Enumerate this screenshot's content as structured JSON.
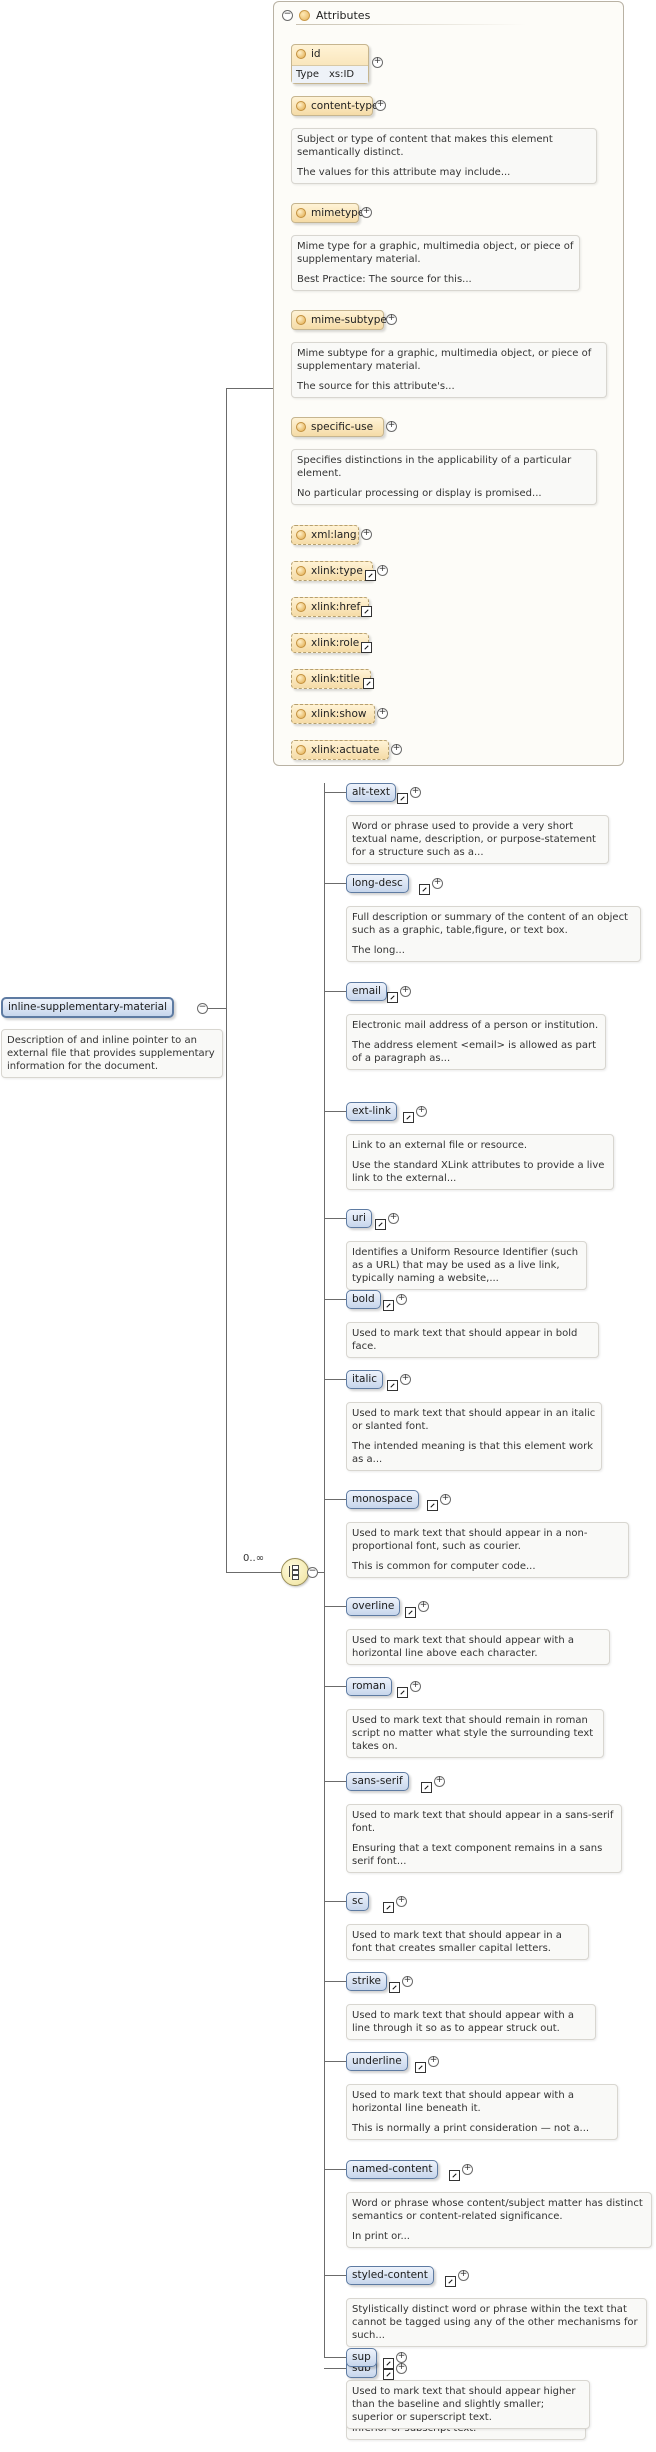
{
  "root": {
    "name": "inline-supplementary-material",
    "description": [
      "Description of and inline pointer to an external file that provides supplementary information for the document."
    ]
  },
  "attributes_group": {
    "label": "Attributes",
    "items": [
      {
        "name": "id",
        "type_label": "Type",
        "type_value": "xs:ID",
        "description": []
      },
      {
        "name": "content-type",
        "description": [
          "Subject or type of content that makes this element semantically distinct.",
          "The values for this attribute may include..."
        ]
      },
      {
        "name": "mimetype",
        "description": [
          "Mime type for a graphic, multimedia object, or piece of supplementary material.",
          "Best Practice: The source for this..."
        ]
      },
      {
        "name": "mime-subtype",
        "description": [
          "Mime subtype for a graphic, multimedia object, or piece of supplementary material.",
          "The source for this attribute's..."
        ]
      },
      {
        "name": "specific-use",
        "description": [
          "Specifies distinctions in the applicability of a particular element.",
          "No particular processing or display is promised..."
        ]
      },
      {
        "name": "xml:lang",
        "description": []
      },
      {
        "name": "xlink:type",
        "description": []
      },
      {
        "name": "xlink:href",
        "description": []
      },
      {
        "name": "xlink:role",
        "description": []
      },
      {
        "name": "xlink:title",
        "description": []
      },
      {
        "name": "xlink:show",
        "description": []
      },
      {
        "name": "xlink:actuate",
        "description": []
      }
    ]
  },
  "choice": {
    "occurrence": "0..∞"
  },
  "children": [
    {
      "name": "alt-text",
      "description": [
        "Word or phrase used to provide a very short textual name, description, or purpose-statement for a structure such as a..."
      ]
    },
    {
      "name": "long-desc",
      "description": [
        "Full description or summary of the content of an object such as a graphic, table,figure, or text box.",
        "The long..."
      ]
    },
    {
      "name": "email",
      "description": [
        "Electronic mail address of a person or institution.",
        "The address element <email> is allowed as part of a paragraph as..."
      ]
    },
    {
      "name": "ext-link",
      "description": [
        "Link to an external file or resource.",
        "Use the standard XLink attributes to provide a live link to the external..."
      ]
    },
    {
      "name": "uri",
      "description": [
        "Identifies a Uniform Resource Identifier (such as a URL) that may be used as a live link, typically naming a website,..."
      ]
    },
    {
      "name": "bold",
      "description": [
        "Used to mark text that should appear in bold face."
      ]
    },
    {
      "name": "italic",
      "description": [
        "Used to mark text that should appear in an italic or slanted font.",
        "The intended meaning is that this element work as a..."
      ]
    },
    {
      "name": "monospace",
      "description": [
        "Used to mark text that should appear in a non-proportional font, such as courier.",
        "This is common for computer code..."
      ]
    },
    {
      "name": "overline",
      "description": [
        "Used to mark text that should appear with a horizontal line above each character."
      ]
    },
    {
      "name": "roman",
      "description": [
        "Used to mark text that should remain in roman script no matter what style the surrounding text takes on."
      ]
    },
    {
      "name": "sans-serif",
      "description": [
        "Used to mark text that should appear in a sans-serif font.",
        "Ensuring that a text component remains in a sans serif font..."
      ]
    },
    {
      "name": "sc",
      "description": [
        "Used to mark text that should appear in a font that creates smaller capital letters."
      ]
    },
    {
      "name": "strike",
      "description": [
        "Used to mark text that should appear with a line through it so as to appear struck out."
      ]
    },
    {
      "name": "underline",
      "description": [
        "Used to mark text that should appear with a horizontal line beneath it.",
        "This is normally a print consideration — not a..."
      ]
    },
    {
      "name": "named-content",
      "description": [
        "Word or phrase whose content/subject matter has distinct semantics or content-related significance.",
        "In print or..."
      ]
    },
    {
      "name": "styled-content",
      "description": [
        "Stylistically distinct word or phrase within the text that cannot be tagged using any of the other mechanisms for such..."
      ]
    },
    {
      "name": "sub",
      "description": [
        "Used to mark text that should appear lower than the baseline and slightly smaller; inferior or subscript text."
      ]
    },
    {
      "name": "sup",
      "description": [
        "Used to mark text that should appear higher than the baseline and slightly smaller; superior or superscript text."
      ]
    }
  ]
}
